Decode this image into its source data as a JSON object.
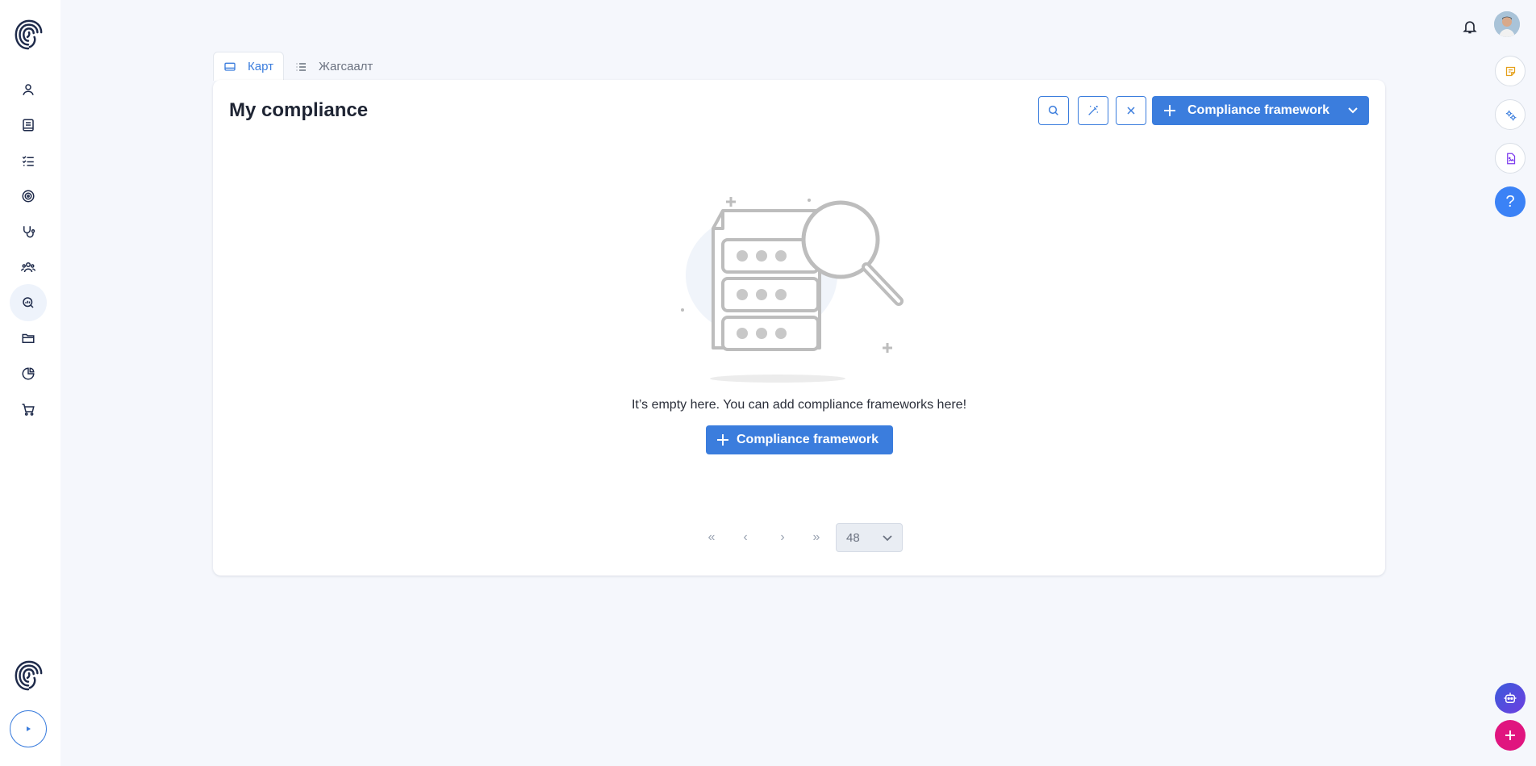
{
  "tabs": [
    {
      "label": "Карт",
      "icon": "card-view-icon",
      "active": true
    },
    {
      "label": "Жагсаалт",
      "icon": "list-view-icon",
      "active": false
    }
  ],
  "page": {
    "title": "My compliance",
    "add_button_label": "Compliance framework"
  },
  "empty_state": {
    "message": "It’s empty here. You can add compliance frameworks here!",
    "button_label": "Compliance framework"
  },
  "pagination": {
    "first": "«",
    "prev": "‹",
    "next": "›",
    "last": "»",
    "page_size": "48"
  },
  "sidebar": {
    "items": [
      {
        "name": "user",
        "icon": "user-icon"
      },
      {
        "name": "book",
        "icon": "book-icon"
      },
      {
        "name": "checklist",
        "icon": "checklist-icon"
      },
      {
        "name": "target",
        "icon": "target-icon"
      },
      {
        "name": "health",
        "icon": "stethoscope-icon"
      },
      {
        "name": "team",
        "icon": "team-icon"
      },
      {
        "name": "compliance",
        "icon": "search-analytics-icon",
        "active": true
      },
      {
        "name": "folder",
        "icon": "folder-icon"
      },
      {
        "name": "reports",
        "icon": "pie-chart-icon"
      },
      {
        "name": "shop",
        "icon": "cart-icon"
      }
    ]
  },
  "help_label": "?",
  "colors": {
    "primary": "#3b7ddd",
    "background": "#f5f7fc",
    "accent_pink": "#e0157f"
  }
}
